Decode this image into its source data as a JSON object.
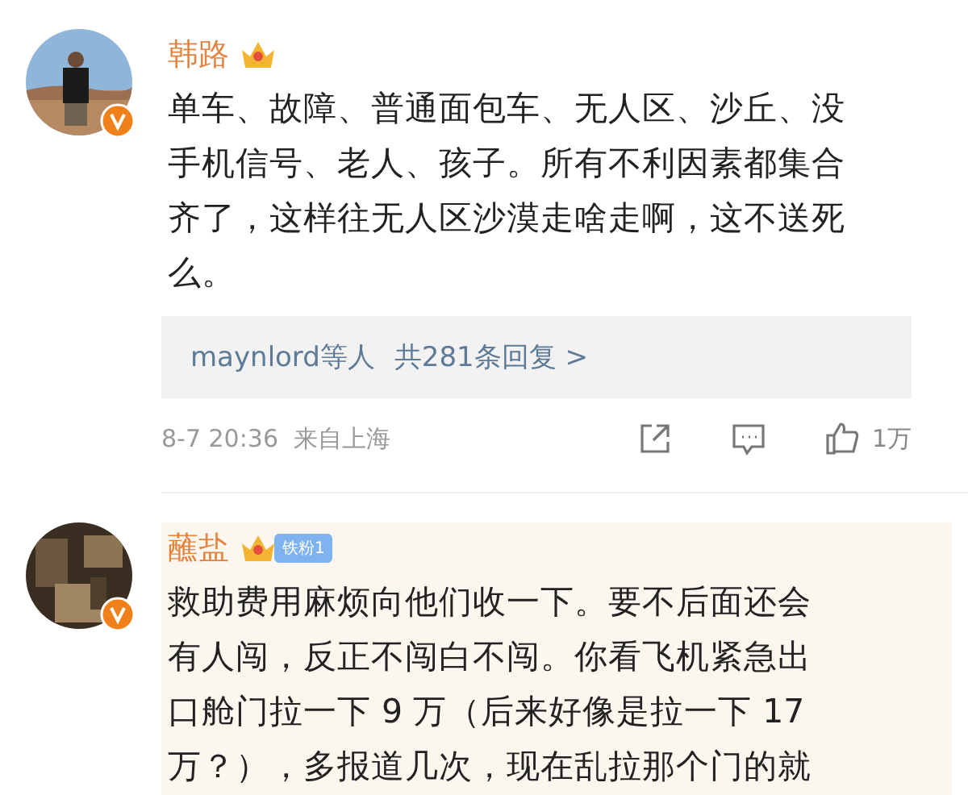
{
  "comments": [
    {
      "name": "韩路",
      "highlighted": false,
      "text_lines": [
        "单车、故障、普通面包车、无人区、沙丘、没",
        "手机信号、老人、孩子。所有不利因素都集合",
        "齐了，这样往无人区沙漠走啥走啊，这不送死",
        "么。"
      ],
      "replies": {
        "who": "maynlord等人",
        "count": "共281条回复 >"
      },
      "meta": {
        "time": "8-7 20:36",
        "location": "来自上海",
        "likes": "1万"
      }
    },
    {
      "name": "蘸盐",
      "badge": "铁粉1",
      "highlighted": true,
      "text_lines": [
        "救助费用麻烦向他们收一下。要不后面还会",
        "有人闯，反正不闯白不闯。你看飞机紧急出",
        "口舱门拉一下 9 万（后来好像是拉一下 17",
        "万？），多报道几次，现在乱拉那个门的就"
      ]
    }
  ]
}
